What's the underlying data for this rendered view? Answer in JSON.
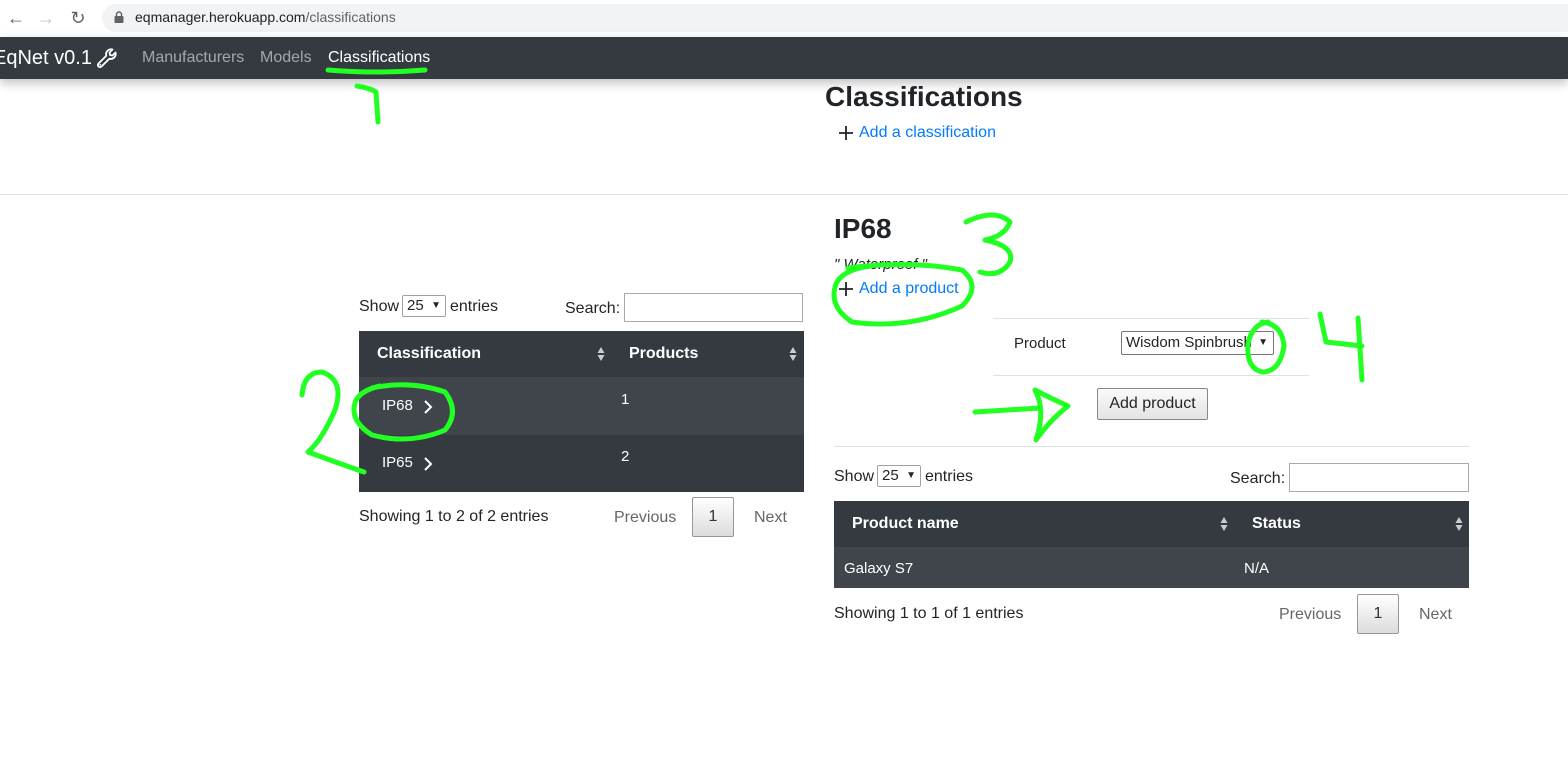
{
  "browser": {
    "url_host": "eqmanager.herokuapp.com",
    "url_path": "/classifications"
  },
  "navbar": {
    "brand": "EqNet v0.1",
    "links": [
      {
        "label": "Manufacturers",
        "active": false
      },
      {
        "label": "Models",
        "active": false
      },
      {
        "label": "Classifications",
        "active": true
      }
    ]
  },
  "page": {
    "title": "Classifications",
    "add_link": "Add a classification"
  },
  "classifications_table": {
    "length_prefix": "Show",
    "length_value": "25",
    "length_suffix": "entries",
    "search_label": "Search:",
    "search_value": "",
    "columns": [
      "Classification",
      "Products"
    ],
    "rows": [
      {
        "classification": "IP68",
        "products": "1",
        "selected": true
      },
      {
        "classification": "IP65",
        "products": "2",
        "selected": false
      }
    ],
    "info": "Showing 1 to 2 of 2 entries",
    "pagination": {
      "previous": "Previous",
      "current": "1",
      "next": "Next"
    }
  },
  "detail": {
    "title": "IP68",
    "description": "\" Waterproof \"",
    "add_product_link": "Add a product",
    "product_label": "Product",
    "product_selected": "Wisdom Spinbrush",
    "add_button": "Add product"
  },
  "products_table": {
    "length_prefix": "Show",
    "length_value": "25",
    "length_suffix": "entries",
    "search_label": "Search:",
    "search_value": "",
    "columns": [
      "Product name",
      "Status"
    ],
    "rows": [
      {
        "name": "Galaxy S7",
        "status": "N/A"
      }
    ],
    "info": "Showing 1 to 1 of 1 entries",
    "pagination": {
      "previous": "Previous",
      "current": "1",
      "next": "Next"
    }
  },
  "annotations": {
    "color": "#22ff22",
    "marks": [
      "1",
      "2",
      "3",
      "4"
    ]
  }
}
